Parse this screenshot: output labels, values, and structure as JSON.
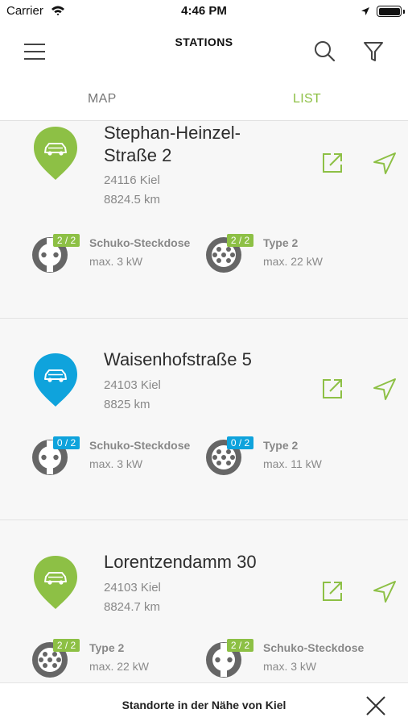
{
  "status_bar": {
    "carrier": "Carrier",
    "time": "4:46 PM"
  },
  "nav": {
    "title": "STATIONS"
  },
  "tabs": [
    {
      "label": "MAP",
      "active": false
    },
    {
      "label": "LIST",
      "active": true
    }
  ],
  "colors": {
    "accent_green": "#8dc045",
    "status_blue": "#0fa3dc",
    "text_dark": "#2d2d2d",
    "text_muted": "#888888",
    "icon_gray": "#666666"
  },
  "icons": {
    "menu": "hamburger-icon",
    "search": "search-icon",
    "filter": "filter-icon",
    "navigate": "navigation-arrow-icon",
    "open": "external-link-icon",
    "close": "close-icon",
    "pin": "car-pin-icon",
    "schuko": "schuko-plug-icon",
    "type2": "type2-plug-icon"
  },
  "stations": [
    {
      "name": "Stephan-Heinzel-\nStraße 2",
      "postal_city": "24116 Kiel",
      "distance": "8824.5 km",
      "pin_color": "green",
      "connectors": [
        {
          "type": "schuko",
          "availability": "2 / 2",
          "status": "green",
          "name": "Schuko-Steckdose",
          "power": "max. 3 kW"
        },
        {
          "type": "type2",
          "availability": "2 / 2",
          "status": "green",
          "name": "Type 2",
          "power": "max. 22 kW"
        }
      ]
    },
    {
      "name": "Waisenhofstraße 5",
      "postal_city": "24103 Kiel",
      "distance": "8825 km",
      "pin_color": "blue",
      "connectors": [
        {
          "type": "schuko",
          "availability": "0 / 2",
          "status": "blue",
          "name": "Schuko-Steckdose",
          "power": "max. 3 kW"
        },
        {
          "type": "type2",
          "availability": "0 / 2",
          "status": "blue",
          "name": "Type 2",
          "power": "max. 11 kW"
        }
      ]
    },
    {
      "name": "Lorentzendamm 30",
      "postal_city": "24103 Kiel",
      "distance": "8824.7 km",
      "pin_color": "green",
      "connectors": [
        {
          "type": "type2",
          "availability": "2 / 2",
          "status": "green",
          "name": "Type 2",
          "power": "max. 22 kW"
        },
        {
          "type": "schuko",
          "availability": "2 / 2",
          "status": "green",
          "name": "Schuko-Steckdose",
          "power": "max. 3 kW"
        }
      ]
    }
  ],
  "bottom_bar": {
    "text": "Standorte in der Nähe von Kiel"
  }
}
